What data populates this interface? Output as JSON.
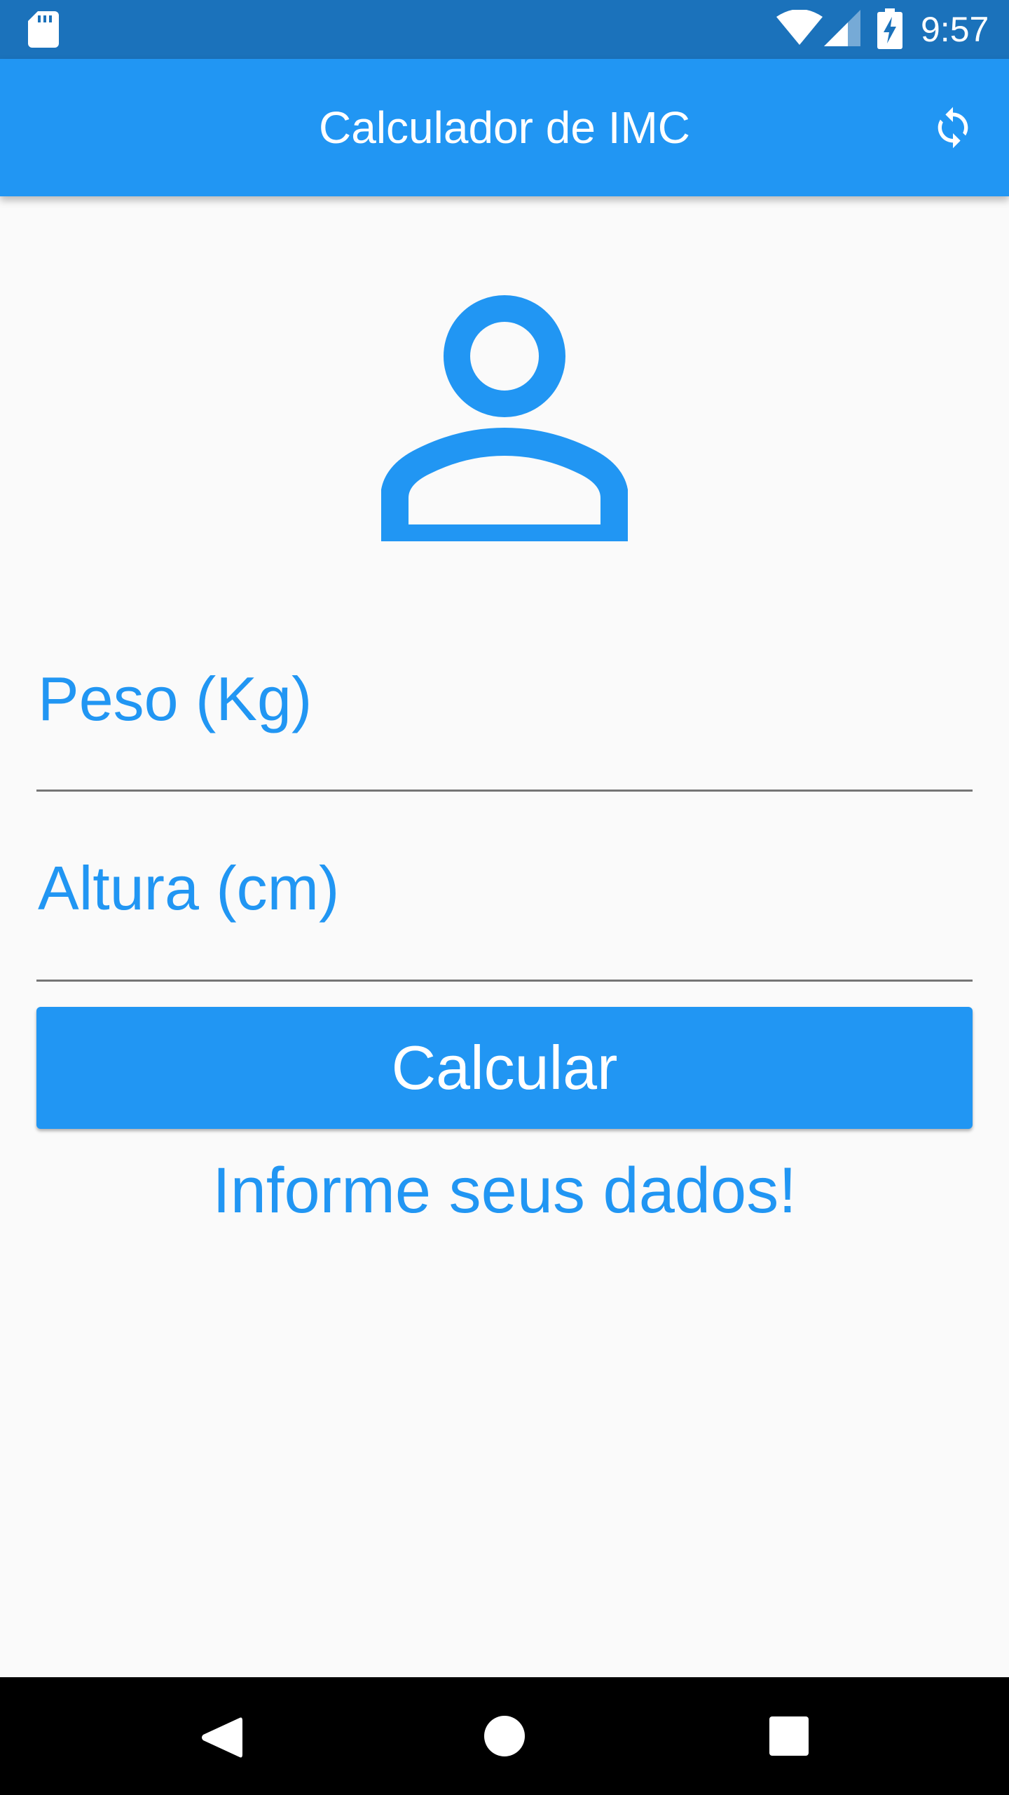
{
  "status_bar": {
    "time": "9:57",
    "icons": [
      "sd-card-icon",
      "wifi-icon",
      "cell-signal-icon",
      "battery-charging-icon"
    ]
  },
  "app_bar": {
    "title": "Calculador de IMC",
    "action_icon": "refresh-icon"
  },
  "form": {
    "avatar_icon": "person-outline-icon",
    "weight": {
      "label": "Peso (Kg)",
      "value": ""
    },
    "height": {
      "label": "Altura (cm)",
      "value": ""
    },
    "calculate_label": "Calcular",
    "info_text": "Informe seus dados!"
  },
  "nav_bar": {
    "icons": [
      "back-icon",
      "home-icon",
      "recents-icon"
    ]
  },
  "colors": {
    "primary": "#2196f3",
    "status_bar": "#1b72bb",
    "background": "#fafafa",
    "nav_bar": "#000000",
    "underline": "#757575"
  }
}
